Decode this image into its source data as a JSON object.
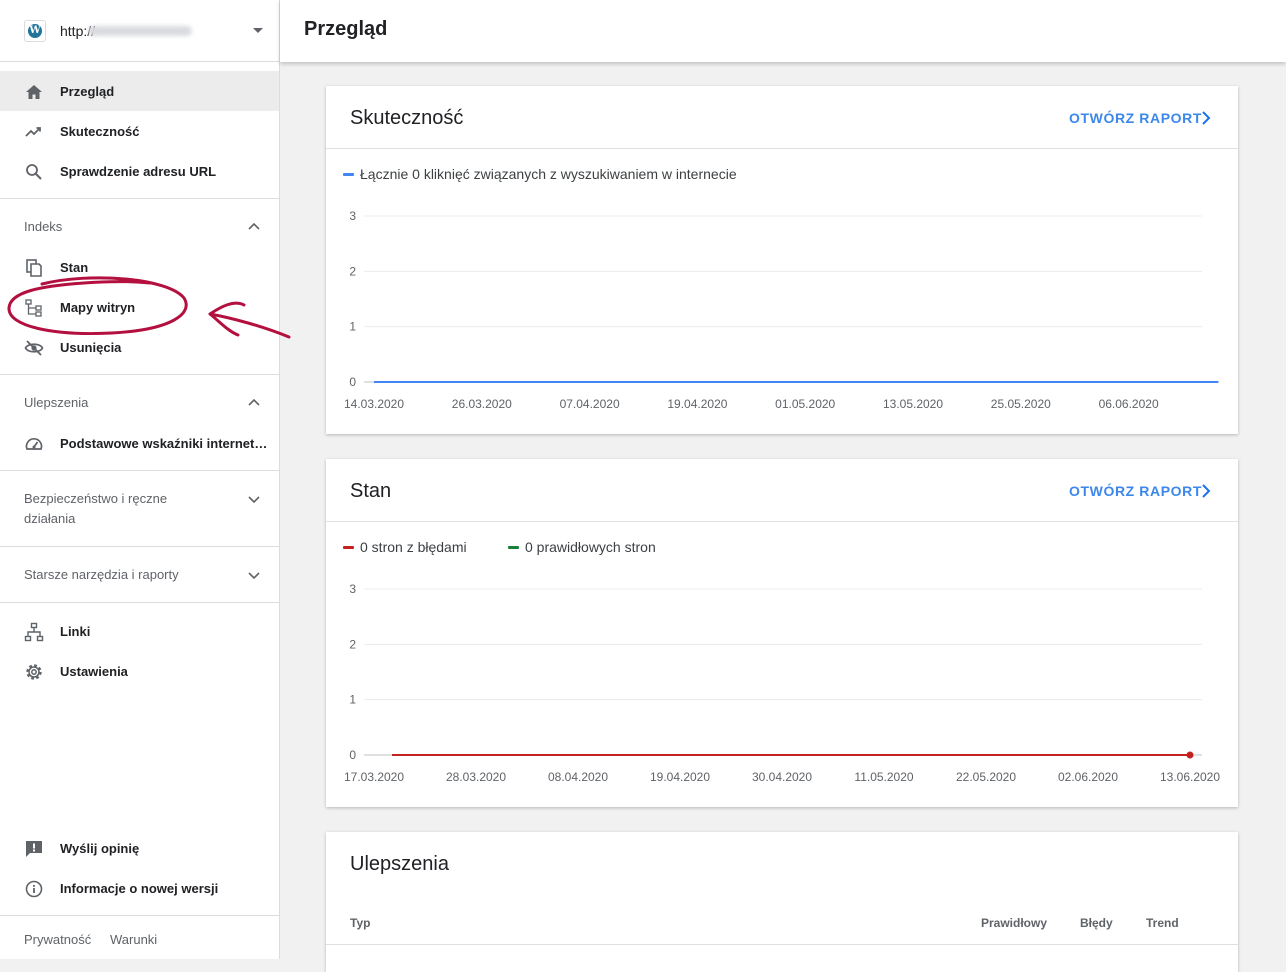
{
  "sidebar": {
    "property_url": "http://",
    "items_top": [
      {
        "label": "Przegląd",
        "icon": "home-icon",
        "active": true
      },
      {
        "label": "Skuteczność",
        "icon": "trending-up-icon"
      },
      {
        "label": "Sprawdzenie adresu URL",
        "icon": "search-icon"
      }
    ],
    "index_section": {
      "title": "Indeks",
      "items": [
        {
          "label": "Stan",
          "icon": "copy-pages-icon"
        },
        {
          "label": "Mapy witryn",
          "icon": "sitemap-icon"
        },
        {
          "label": "Usunięcia",
          "icon": "eye-off-icon"
        }
      ]
    },
    "enhancements_section": {
      "title": "Ulepszenia",
      "items": [
        {
          "label": "Podstawowe wskaźniki internet…",
          "icon": "speedometer-icon"
        }
      ]
    },
    "security_section": {
      "title_line1": "Bezpieczeństwo i ręczne",
      "title_line2": "działania"
    },
    "legacy_section": {
      "title": "Starsze narzędzia i raporty"
    },
    "items_bottom": [
      {
        "label": "Linki",
        "icon": "links-icon"
      },
      {
        "label": "Ustawienia",
        "icon": "gear-icon"
      }
    ],
    "items_footer": [
      {
        "label": "Wyślij opinię",
        "icon": "feedback-icon"
      },
      {
        "label": "Informacje o nowej wersji",
        "icon": "info-icon"
      }
    ],
    "footer_links": {
      "privacy": "Prywatność",
      "terms": "Warunki"
    }
  },
  "header": {
    "title": "Przegląd"
  },
  "cards": {
    "performance": {
      "title": "Skuteczność",
      "open_report": "OTWÓRZ RAPORT",
      "legend": "Łącznie 0 kliknięć związanych z wyszukiwaniem w internecie",
      "legend_color": "#4285f4"
    },
    "coverage": {
      "title": "Stan",
      "open_report": "OTWÓRZ RAPORT",
      "legend_errors": "0 stron z błędami",
      "legend_valid": "0 prawidłowych stron",
      "error_color": "#c5221f",
      "valid_color": "#188038"
    },
    "enhancements": {
      "title": "Ulepszenia",
      "col_type": "Typ",
      "col_valid": "Prawidłowy",
      "col_errors": "Błędy",
      "col_trend": "Trend"
    }
  },
  "chart_data": [
    {
      "type": "line",
      "yticks": [
        0,
        1,
        2,
        3
      ],
      "ylim": [
        0,
        3
      ],
      "xtick_labels": [
        "14.03.2020",
        "26.03.2020",
        "07.04.2020",
        "19.04.2020",
        "01.05.2020",
        "13.05.2020",
        "25.05.2020",
        "06.06.2020"
      ],
      "series": [
        {
          "name": "Łącznie 0 kliknięć związanych z wyszukiwaniem w internecie",
          "color": "#4285f4",
          "x": [
            "14.03.2020",
            "16.06.2020"
          ],
          "values": [
            0,
            0
          ]
        }
      ]
    },
    {
      "type": "line",
      "yticks": [
        0,
        1,
        2,
        3
      ],
      "ylim": [
        0,
        3
      ],
      "xtick_labels": [
        "17.03.2020",
        "28.03.2020",
        "08.04.2020",
        "19.04.2020",
        "30.04.2020",
        "11.05.2020",
        "22.05.2020",
        "02.06.2020",
        "13.06.2020"
      ],
      "series": [
        {
          "name": "0 stron z błędami",
          "color": "#c5221f",
          "x": [
            "17.03.2020",
            "13.06.2020"
          ],
          "values": [
            0,
            0
          ]
        }
      ]
    }
  ]
}
